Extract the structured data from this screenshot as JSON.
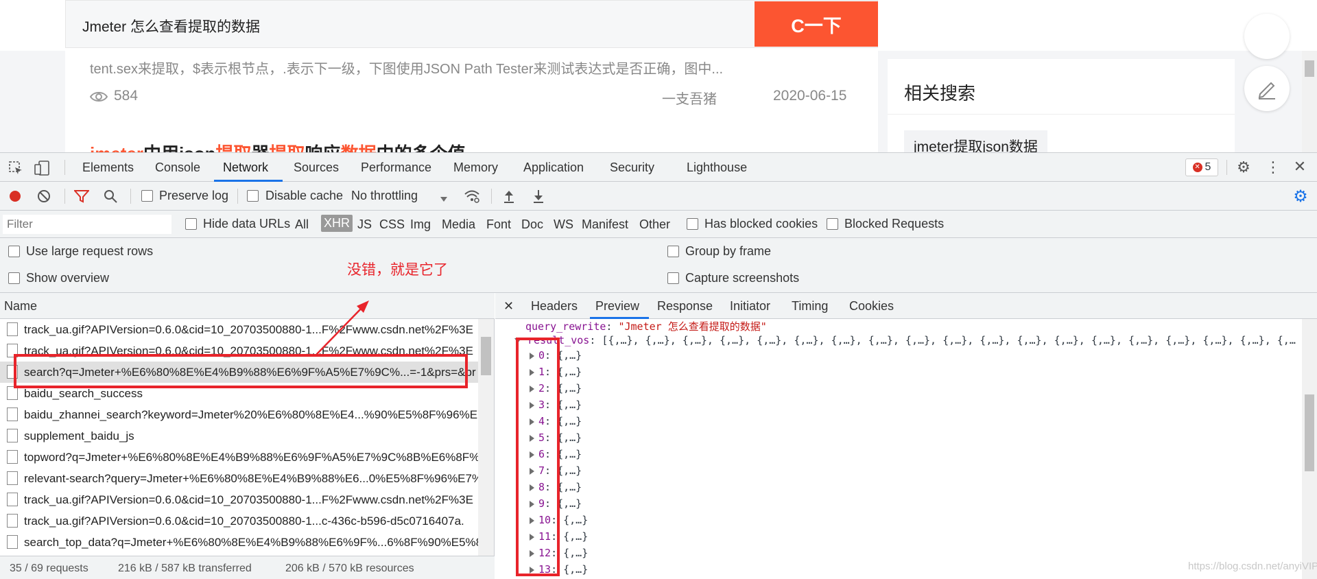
{
  "page": {
    "search_query": "Jmeter 怎么查看提取的数据",
    "search_button": "C一下",
    "result": {
      "snippet": "tent.sex来提取，$表示根节点，.表示下一级，下图使用JSON Path Tester来测试表达式是否正确，图中...",
      "views": "584",
      "author": "一支吾猪",
      "date": "2020-06-15",
      "next_title_parts": [
        "jmeter",
        "中用json",
        "提取",
        "器",
        "提取",
        "响应",
        "数据",
        "中的多个值"
      ]
    },
    "sidebar": {
      "title": "相关搜索",
      "chip": "jmeter提取json数据"
    }
  },
  "devtools": {
    "tabs": [
      "Elements",
      "Console",
      "Network",
      "Sources",
      "Performance",
      "Memory",
      "Application",
      "Security",
      "Lighthouse"
    ],
    "active_tab": "Network",
    "error_count": "5",
    "toolbar": {
      "preserve_log": "Preserve log",
      "disable_cache": "Disable cache",
      "throttling": "No throttling"
    },
    "filter": {
      "placeholder": "Filter",
      "hide_data_urls": "Hide data URLs",
      "types": [
        "All",
        "XHR",
        "JS",
        "CSS",
        "Img",
        "Media",
        "Font",
        "Doc",
        "WS",
        "Manifest",
        "Other"
      ],
      "active_type": "XHR",
      "has_blocked_cookies": "Has blocked cookies",
      "blocked_requests": "Blocked Requests"
    },
    "settings": {
      "large_rows": "Use large request rows",
      "show_overview": "Show overview",
      "group_by_frame": "Group by frame",
      "capture_screenshots": "Capture screenshots"
    },
    "annotation": "没错，就是它了",
    "list_header": "Name",
    "requests": [
      "track_ua.gif?APIVersion=0.6.0&cid=10_20703500880-1...F%2Fwww.csdn.net%2F%3E",
      "track_ua.gif?APIVersion=0.6.0&cid=10_20703500880-1...F%2Fwww.csdn.net%2F%3E",
      "search?q=Jmeter+%E6%80%8E%E4%B9%88%E6%9F%A5%E7%9C%...=-1&prs=&pr",
      "baidu_search_success",
      "baidu_zhannei_search?keyword=Jmeter%20%E6%80%8E%E4...%90%E5%8F%96%E7",
      "supplement_baidu_js",
      "topword?q=Jmeter+%E6%80%8E%E4%B9%88%E6%9F%A5%E7%9C%8B%E6%8F%9",
      "relevant-search?query=Jmeter+%E6%80%8E%E4%B9%88%E6...0%E5%8F%96%E7%",
      "track_ua.gif?APIVersion=0.6.0&cid=10_20703500880-1...F%2Fwww.csdn.net%2F%3E",
      "track_ua.gif?APIVersion=0.6.0&cid=10_20703500880-1...c-436c-b596-d5c0716407a.",
      "search_top_data?q=Jmeter+%E6%80%8E%E4%B9%88%E6%9F%...6%8F%90%E5%8."
    ],
    "selected_request_index": 2,
    "status": {
      "requests": "35 / 69 requests",
      "transferred": "216 kB / 587 kB transferred",
      "resources": "206 kB / 570 kB resources"
    },
    "detail_tabs": [
      "Headers",
      "Preview",
      "Response",
      "Initiator",
      "Timing",
      "Cookies"
    ],
    "active_detail_tab": "Preview",
    "preview": {
      "query_rewrite_key": "query_rewrite",
      "query_rewrite_val": "\"Jmeter 怎么查看提取的数据\"",
      "result_vos_key": "result_vos",
      "result_vos_summary": "[{,…}, {,…}, {,…}, {,…}, {,…}, {,…}, {,…}, {,…}, {,…}, {,…}, {,…}, {,…}, {,…}, {,…}, {,…}, {,…}, {,…}, {,…}, {,…",
      "items": [
        "0",
        "1",
        "2",
        "3",
        "4",
        "5",
        "6",
        "7",
        "8",
        "9",
        "10",
        "11",
        "12",
        "13"
      ],
      "item_value": "{,…}"
    },
    "watermark": "https://blog.csdn.net/anyiVIP"
  }
}
